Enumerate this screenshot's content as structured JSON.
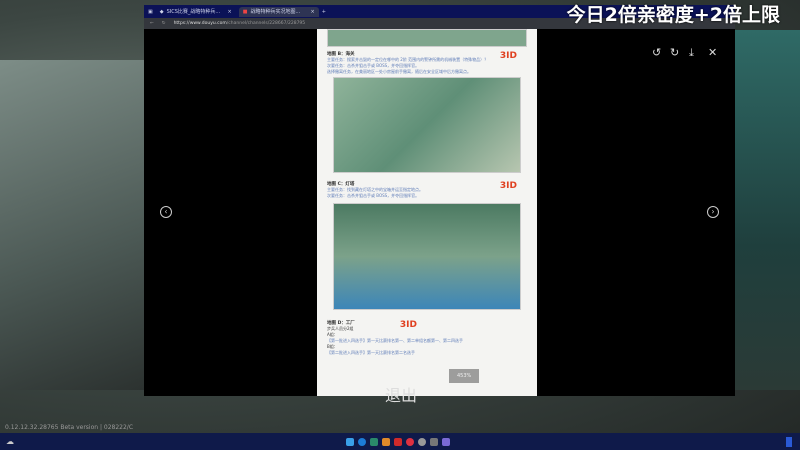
{
  "overlay_text": "今日2倍亲密度+2倍上限",
  "subtitle": "退出",
  "browser": {
    "tabs": [
      {
        "label": "SICS比赛_战略特种兵..."
      },
      {
        "label": "战略特种兵实况地图..."
      }
    ],
    "url_domain": "https://www.douyu.com",
    "url_path": "/channel/channels/228667/228795"
  },
  "viewer": {
    "zoom": "453%",
    "tools": [
      "rotate-left",
      "rotate-right",
      "download",
      "close"
    ]
  },
  "doc": {
    "sections": [
      {
        "title": "地图 B：海关",
        "lines": [
          "主要任务：搜索并击毁的一定位在哪中的 2阶 范围内的警钟所需的机械装置（特殊物品）？",
          "次要任务：击杀并狙击手或 BOSS，并夺回指挥官。",
          "选择撤离任务，在美丽地区一处小房屋前手撤离，随后在安全区域中后方撤离点。"
        ]
      },
      {
        "title": "地图 C：灯塔",
        "lines": [
          "主要任务：找到藏在灯塔之中的宝箱并运至指定地点。",
          "次要任务：击杀并狙击手或 BOSS，并夺回指挥官。"
        ]
      },
      {
        "title": "地图 D：工厂",
        "lines": [
          "步兵人员分2组",
          "A组：",
          "【第一批进入四选手】第一天比赛排名第一、第二单组名额第一、第二四选手",
          "B组：",
          "【第二批进入四选手】第一天比赛排名第二名选手"
        ]
      }
    ],
    "logo": "3ID"
  },
  "status_text": "0.12.12.32.28765 Beta version | 028222/C"
}
